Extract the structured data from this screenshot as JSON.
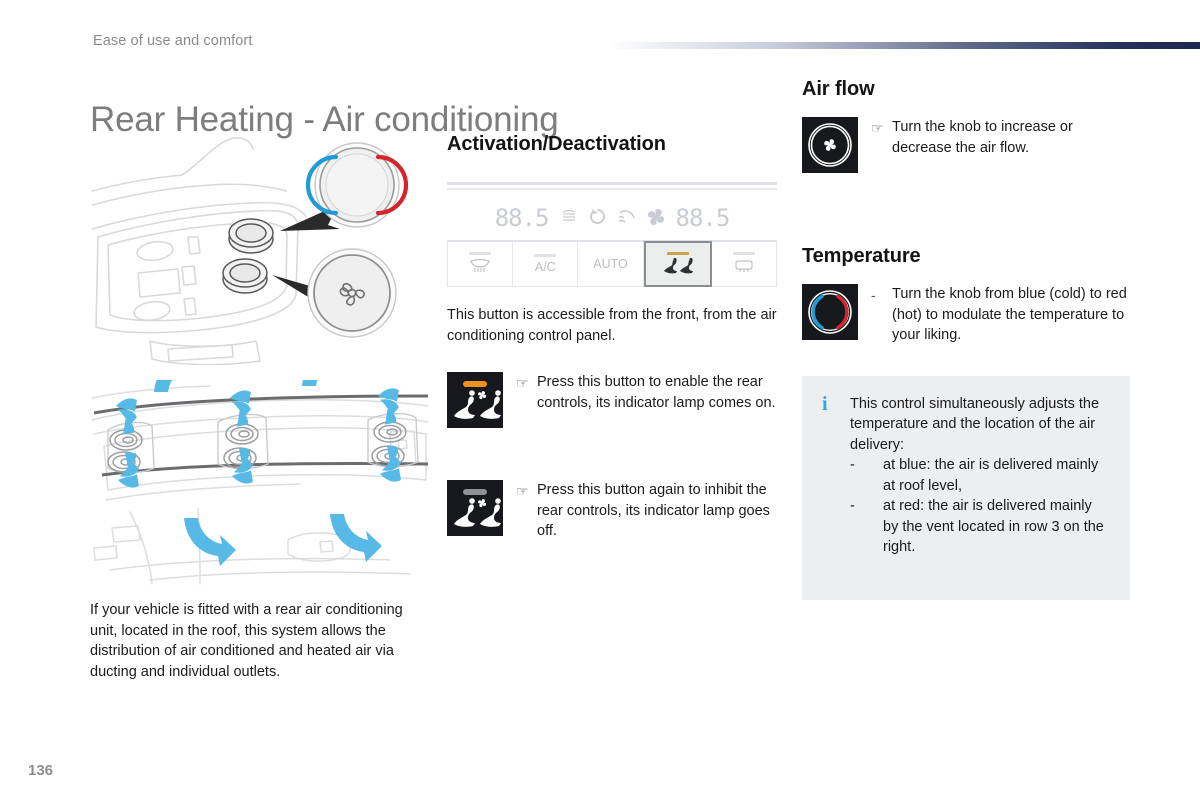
{
  "header": {
    "running_head": "Ease of use and comfort",
    "title": "Rear Heating - Air conditioning"
  },
  "footer": {
    "page_number": "136"
  },
  "left_column": {
    "illustration_top_name": "roof-console-knobs-illustration",
    "illustration_bottom_name": "roof-air-vents-illustration",
    "paragraph": "If your vehicle is fitted with a rear air conditioning unit, located in the roof, this system allows the distribution of air conditioned and heated air via ducting and individual outlets."
  },
  "middle_column": {
    "heading": "Activation/Deactivation",
    "control_panel": {
      "lcd": {
        "left_temperature": "88.5",
        "right_temperature": "88.5",
        "icons": [
          "auto-soft-icon",
          "recirculation-icon",
          "demist-icon",
          "fan-icon"
        ]
      },
      "buttons": [
        {
          "label": "",
          "icon": "rear-screen-demist-icon",
          "active": false
        },
        {
          "label": "A/C",
          "icon": "",
          "active": false
        },
        {
          "label": "AUTO",
          "icon": "",
          "active": false
        },
        {
          "label": "",
          "icon": "rear-controls-icon",
          "active": true
        },
        {
          "label": "",
          "icon": "windscreen-demist-icon",
          "active": false
        }
      ]
    },
    "paragraph": "This button is accessible from the front, from the air conditioning control panel.",
    "items": [
      {
        "swatch": "rear-controls-lamp-on",
        "marker": "☞",
        "text": "Press this button to enable the rear controls, its indicator lamp comes on."
      },
      {
        "swatch": "rear-controls-lamp-off",
        "marker": "☞",
        "text": "Press this button again to inhibit the rear controls, its indicator lamp goes off."
      }
    ]
  },
  "right_column": {
    "air_flow": {
      "heading": "Air flow",
      "swatch": "fan-knob-icon",
      "marker": "☞",
      "text": "Turn the knob to increase or decrease the air flow."
    },
    "temperature": {
      "heading": "Temperature",
      "swatch": "temperature-knob-icon",
      "marker": "-",
      "text": "Turn the knob from blue (cold) to red (hot) to modulate the temperature to your liking."
    },
    "info_box": {
      "icon": "i",
      "intro": "This control simultaneously adjusts the temperature and the location of the air delivery:",
      "bullets": [
        {
          "dash": "-",
          "text": "at blue: the air is delivered mainly at roof level,"
        },
        {
          "dash": "-",
          "text": "at red: the air is delivered mainly by the vent located in row 3 on the right."
        }
      ]
    }
  },
  "colors": {
    "cold_blue": "#1f9bd6",
    "hot_red": "#d4242c",
    "lamp_on_orange": "#f0901f",
    "lamp_off_grey": "#8e9196",
    "info_accent": "#2fa8e0",
    "header_rule_dark": "#1d2750",
    "title_grey": "#7d7d7d"
  }
}
